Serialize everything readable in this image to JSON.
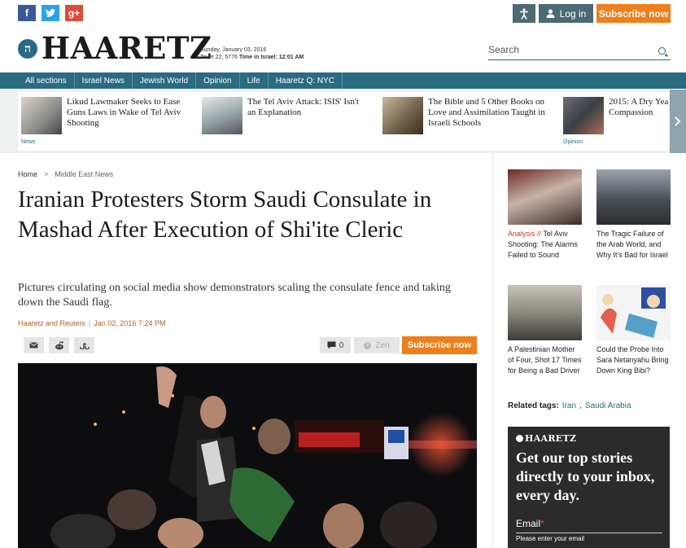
{
  "social": {
    "facebook": "f",
    "twitter": "t",
    "googleplus": "g+"
  },
  "topbar": {
    "accessibility_icon": "accessibility-icon",
    "login_label": "Log in",
    "subscribe_label": "Subscribe now"
  },
  "brand": {
    "logo_mark": "ה",
    "logo_text": "HAARETZ",
    "date_line1": "Sunday, January 03, 2016",
    "date_line2_prefix": "Tevet 22, 5776 ",
    "date_time_label": "Time in Israel: 12:01 AM"
  },
  "search": {
    "placeholder": "Search"
  },
  "nav": {
    "items": [
      "All sections",
      "Israel News",
      "Jewish World",
      "Opinion",
      "Life",
      "Haaretz Q: NYC"
    ]
  },
  "teasers": [
    {
      "title": "Likud Lawmaker Seeks to Ease Guns Laws in Wake of Tel Aviv Shooting",
      "section": "News"
    },
    {
      "title": "The Tel Aviv Attack: ISIS' Isn't an Explanation",
      "section": ""
    },
    {
      "title": "The Bible and 5 Other Books on Love and Assimilation Taught in Israeli Schools",
      "section": ""
    },
    {
      "title": "2015: A Dry Yea Compassion",
      "section": "Opinion"
    }
  ],
  "breadcrumb": {
    "home": "Home",
    "separator": ">",
    "current": "Middle East News"
  },
  "article": {
    "headline": "Iranian Protesters Storm Saudi Consulate in Mashad After Execution of Shi'ite Cleric",
    "subhead": "Pictures circulating on social media show demonstrators scaling the consulate fence and taking down the Saudi flag.",
    "byline": "Haaretz and Reuters",
    "byline_sep": "|",
    "date": "Jan 02, 2016 7:24 PM",
    "comment_count": "0",
    "zen_label": "Zen",
    "subscribe_label": "Subscribe now"
  },
  "sidebar": {
    "cards": [
      {
        "label": "Analysis // ",
        "title": "Tel Aviv Shooting: The Alarms Failed to Sound"
      },
      {
        "label": "",
        "title": "The Tragic Failure of the Arab World, and Why It's Bad for Israel"
      },
      {
        "label": "",
        "title": "A Palestinian Mother of Four, Shot 17 Times for Being a Bad Driver"
      },
      {
        "label": "",
        "title": "Could the Probe Into Sara Netanyahu Bring Down King Bibi?"
      }
    ],
    "related_tags_label": "Related tags:",
    "tags": [
      "Iran",
      "Saudi Arabia"
    ],
    "tag_sep": ","
  },
  "newsletter": {
    "logo": "HAARETZ",
    "title": "Get our top stories directly to your inbox, every day.",
    "email_label": "Email",
    "required_mark": "*",
    "placeholder": "Please enter your email"
  },
  "colors": {
    "brand": "#2a6b82",
    "accent": "#ee7f1a",
    "facebook": "#3b5998",
    "twitter": "#2aa3e6",
    "googleplus": "#dd4b39"
  }
}
